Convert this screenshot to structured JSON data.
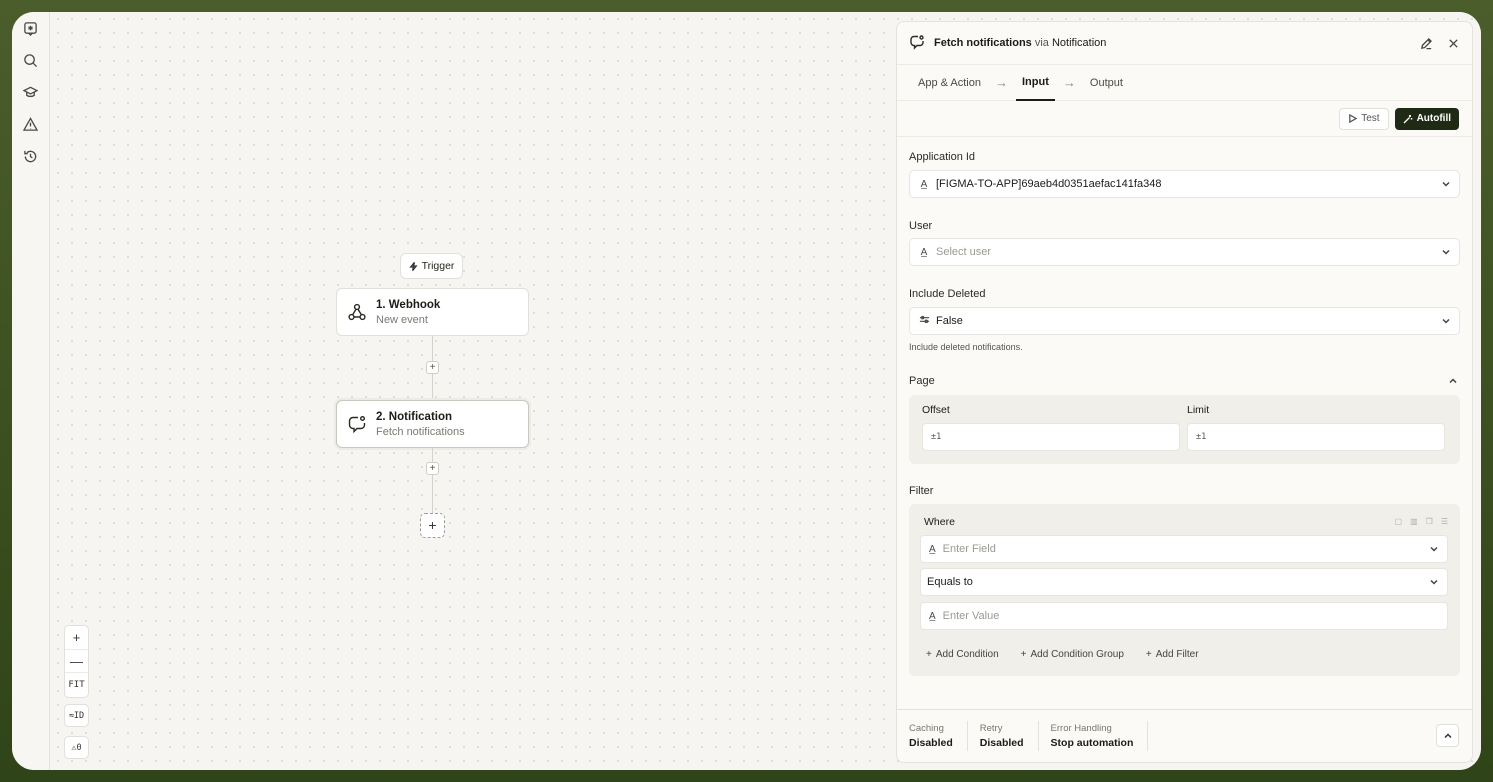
{
  "canvas": {
    "trigger_label": "Trigger",
    "nodes": [
      {
        "title": "1. Webhook",
        "subtitle": "New event"
      },
      {
        "title": "2. Notification",
        "subtitle": "Fetch notifications"
      }
    ],
    "zoom": {
      "in": "+",
      "out": "—",
      "fit": "FIT"
    },
    "id_toggle": "≈ID",
    "warnings": "⚠0"
  },
  "panel": {
    "title": "Fetch notifications",
    "title_via": "via",
    "title_app": "Notification",
    "tabs": [
      "App & Action",
      "Input",
      "Output"
    ],
    "active_tab": "Input",
    "test_label": "Test",
    "autofill_label": "Autofill",
    "fields": {
      "application_id": {
        "label": "Application Id",
        "value": "[FIGMA-TO-APP]69aeb4d0351aefac141fa348"
      },
      "user": {
        "label": "User",
        "placeholder": "Select user"
      },
      "include_deleted": {
        "label": "Include Deleted",
        "value": "False",
        "hint": "Include deleted notifications."
      }
    },
    "page": {
      "label": "Page",
      "offset_label": "Offset",
      "offset_value": "±1",
      "limit_label": "Limit",
      "limit_value": "±1"
    },
    "filter": {
      "label": "Filter",
      "where_label": "Where",
      "field_placeholder": "Enter Field",
      "operator": "Equals to",
      "value_placeholder": "Enter Value",
      "add_condition": "Add Condition",
      "add_condition_group": "Add Condition Group",
      "add_filter": "Add Filter"
    },
    "footer": [
      {
        "label": "Caching",
        "value": "Disabled"
      },
      {
        "label": "Retry",
        "value": "Disabled"
      },
      {
        "label": "Error Handling",
        "value": "Stop automation"
      }
    ]
  }
}
